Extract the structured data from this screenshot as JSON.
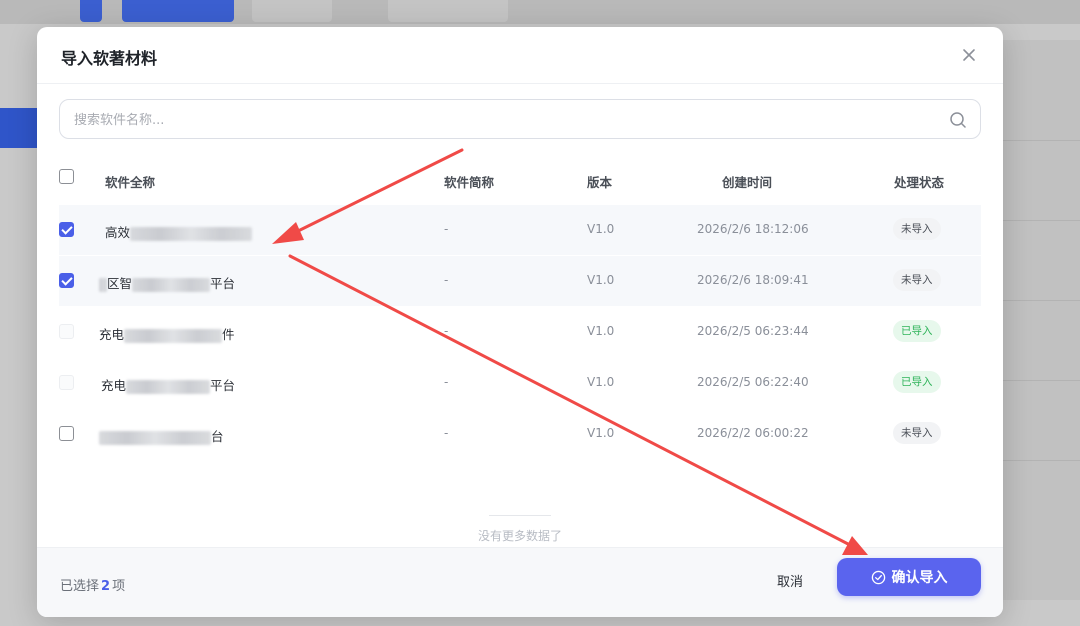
{
  "modal": {
    "title": "导入软著材料",
    "search": {
      "placeholder": "搜索软件名称..."
    }
  },
  "table": {
    "headers": {
      "full_name": "软件全称",
      "short_name": "软件简称",
      "version": "版本",
      "created": "创建时间",
      "status": "处理状态"
    },
    "rows": [
      {
        "name_prefix": "高效",
        "name_suffix": "",
        "short_name": "-",
        "version": "V1.0",
        "created": "2026/2/6 18:12:06",
        "status": "未导入",
        "checked": true
      },
      {
        "name_prefix": "区智",
        "name_suffix": "平台",
        "short_name": "-",
        "version": "V1.0",
        "created": "2026/2/6 18:09:41",
        "status": "未导入",
        "checked": true
      },
      {
        "name_prefix": "充电",
        "name_suffix": "件",
        "short_name": "-",
        "version": "V1.0",
        "created": "2026/2/5 06:23:44",
        "status": "已导入",
        "checked": false
      },
      {
        "name_prefix": "充电",
        "name_suffix": "平台",
        "short_name": "-",
        "version": "V1.0",
        "created": "2026/2/5 06:22:40",
        "status": "已导入",
        "checked": false
      },
      {
        "name_prefix": "",
        "name_suffix": "台",
        "short_name": "-",
        "version": "V1.0",
        "created": "2026/2/2 06:00:22",
        "status": "未导入",
        "checked": false
      }
    ],
    "no_more": "没有更多数据了"
  },
  "footer": {
    "selected_prefix": "已选择",
    "selected_count": "2",
    "selected_suffix": "项",
    "cancel_label": "取消",
    "confirm_label": "确认导入"
  },
  "colors": {
    "accent": "#5a64ee",
    "annotation_arrow": "#f04a47",
    "status_done": "#2fb35a"
  }
}
